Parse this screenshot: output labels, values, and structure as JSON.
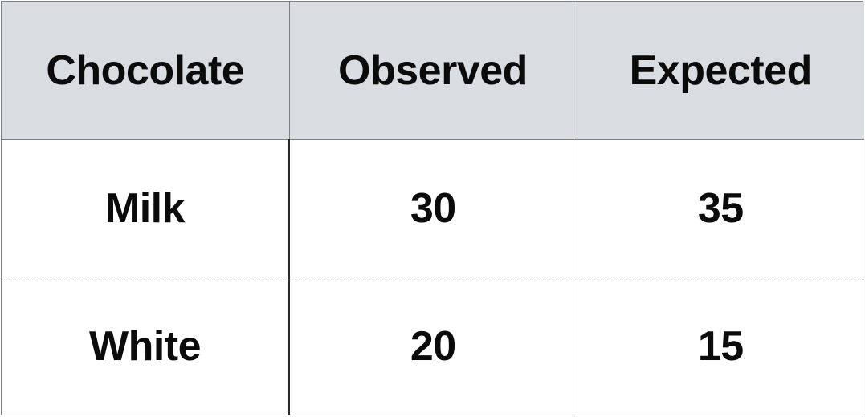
{
  "table": {
    "headers": [
      "Chocolate",
      "Observed",
      "Expected"
    ],
    "rows": [
      [
        "Milk",
        "30",
        "35"
      ],
      [
        "White",
        "20",
        "15"
      ]
    ]
  },
  "colors": {
    "header_background": "#d9dde1",
    "text": "#0b0b0b",
    "border": "#7d7f82"
  }
}
